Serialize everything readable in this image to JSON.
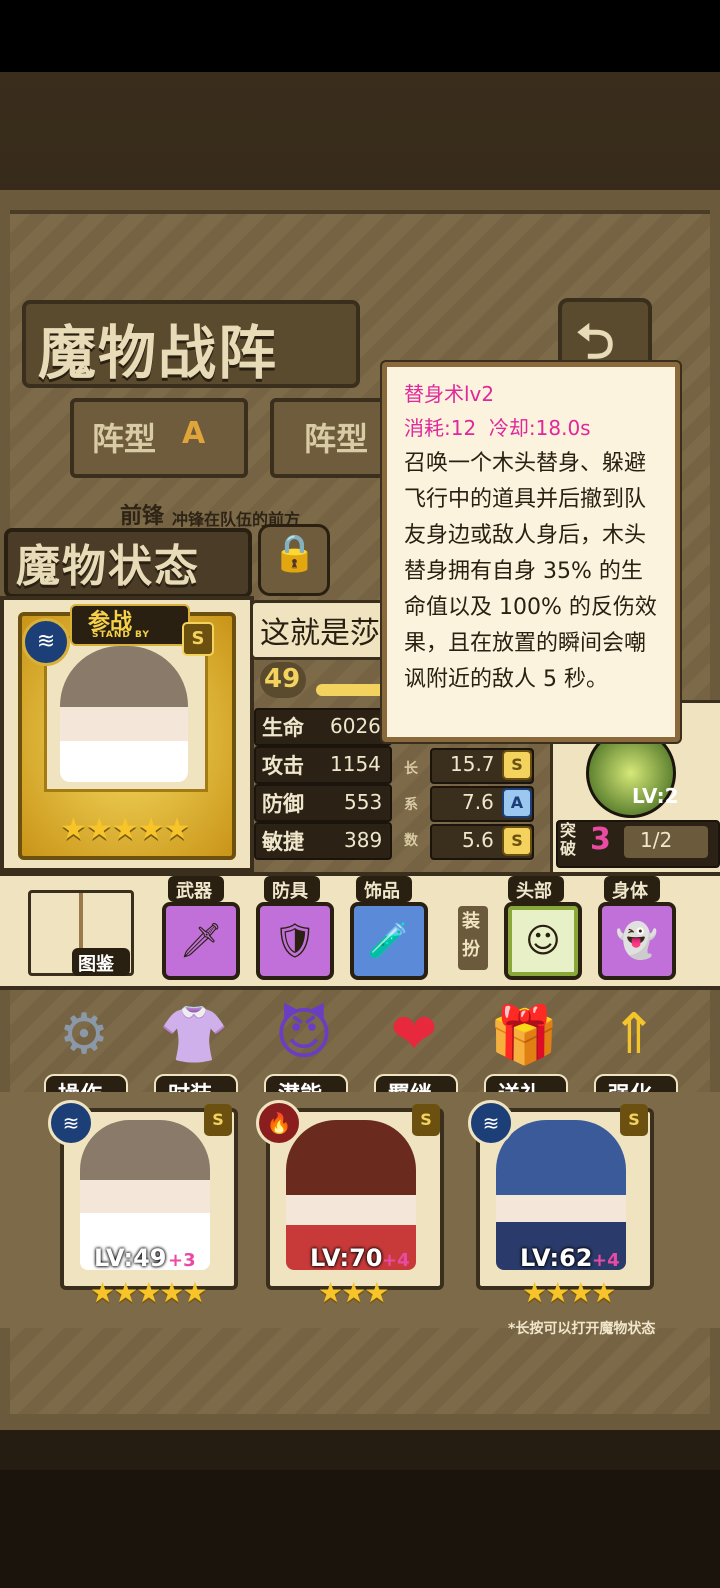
{
  "header": {
    "title": "魔物战阵",
    "back_icon": "return-arrow-icon"
  },
  "tabs": [
    {
      "label": "阵型",
      "letter": "A"
    },
    {
      "label": "阵型"
    }
  ],
  "formation_row": {
    "label": "前锋",
    "desc": "冲锋在队伍的前方"
  },
  "status_panel": {
    "title": "魔物状态",
    "lock_icon": "lock-icon",
    "card": {
      "badge": "参战",
      "badge_sub": "STAND BY",
      "element_icon": "water-icon",
      "rank": "S",
      "stars": "★★★★★"
    },
    "name": "这就是莎",
    "level": "49",
    "stats": [
      {
        "label": "生命",
        "value": "6026"
      },
      {
        "label": "攻击",
        "value": "1154"
      },
      {
        "label": "防御",
        "value": "553"
      },
      {
        "label": "敏捷",
        "value": "389"
      }
    ],
    "growth_axis": [
      "长",
      "系",
      "数"
    ],
    "growth": [
      {
        "value": "15.7",
        "rank": "S"
      },
      {
        "value": "7.6",
        "rank": "A"
      },
      {
        "value": "5.6",
        "rank": "S"
      }
    ],
    "skill": {
      "level_label": "LV:2"
    },
    "breakthrough": {
      "label": "突破",
      "count": "3",
      "fraction": "1/2"
    }
  },
  "tooltip": {
    "title": "替身术lv2",
    "cost_cooldown": "消耗:12  冷却:18.0s",
    "description": "召唤一个木头替身、躲避飞行中的道具并后撤到队友身边或敌人身后，木头替身拥有自身 35% 的生命值以及 100% 的反伤效果，且在放置的瞬间会嘲讽附近的敌人 5 秒。"
  },
  "equipment": {
    "book_label": "图鉴",
    "slots": [
      {
        "label": "武器"
      },
      {
        "label": "防具"
      },
      {
        "label": "饰品"
      }
    ],
    "dress_label": "装扮",
    "dress_slots": [
      {
        "label": "头部"
      },
      {
        "label": "身体"
      }
    ]
  },
  "actions": [
    {
      "label": "操作",
      "icon": "gears-icon"
    },
    {
      "label": "时装",
      "icon": "outfit-icon"
    },
    {
      "label": "潜能",
      "icon": "demon-icon"
    },
    {
      "label": "羁绊",
      "icon": "hearts-icon"
    },
    {
      "label": "送礼",
      "icon": "gift-icon"
    },
    {
      "label": "强化",
      "icon": "arrows-up-icon"
    }
  ],
  "team": [
    {
      "lv": "LV:49",
      "plus": "+3",
      "stars": "★★★★★",
      "element": "water-icon",
      "rank": "S"
    },
    {
      "lv": "LV:70",
      "plus": "+4",
      "stars": "★★★",
      "element": "fire-icon",
      "rank": "S"
    },
    {
      "lv": "LV:62",
      "plus": "+4",
      "stars": "★★★★",
      "element": "water-icon",
      "rank": "S"
    }
  ],
  "hint": "*长按可以打开魔物状态",
  "colors": {
    "accent_pink": "#e0289a",
    "gold": "#f3d35e",
    "parchment": "#efe3c0"
  }
}
